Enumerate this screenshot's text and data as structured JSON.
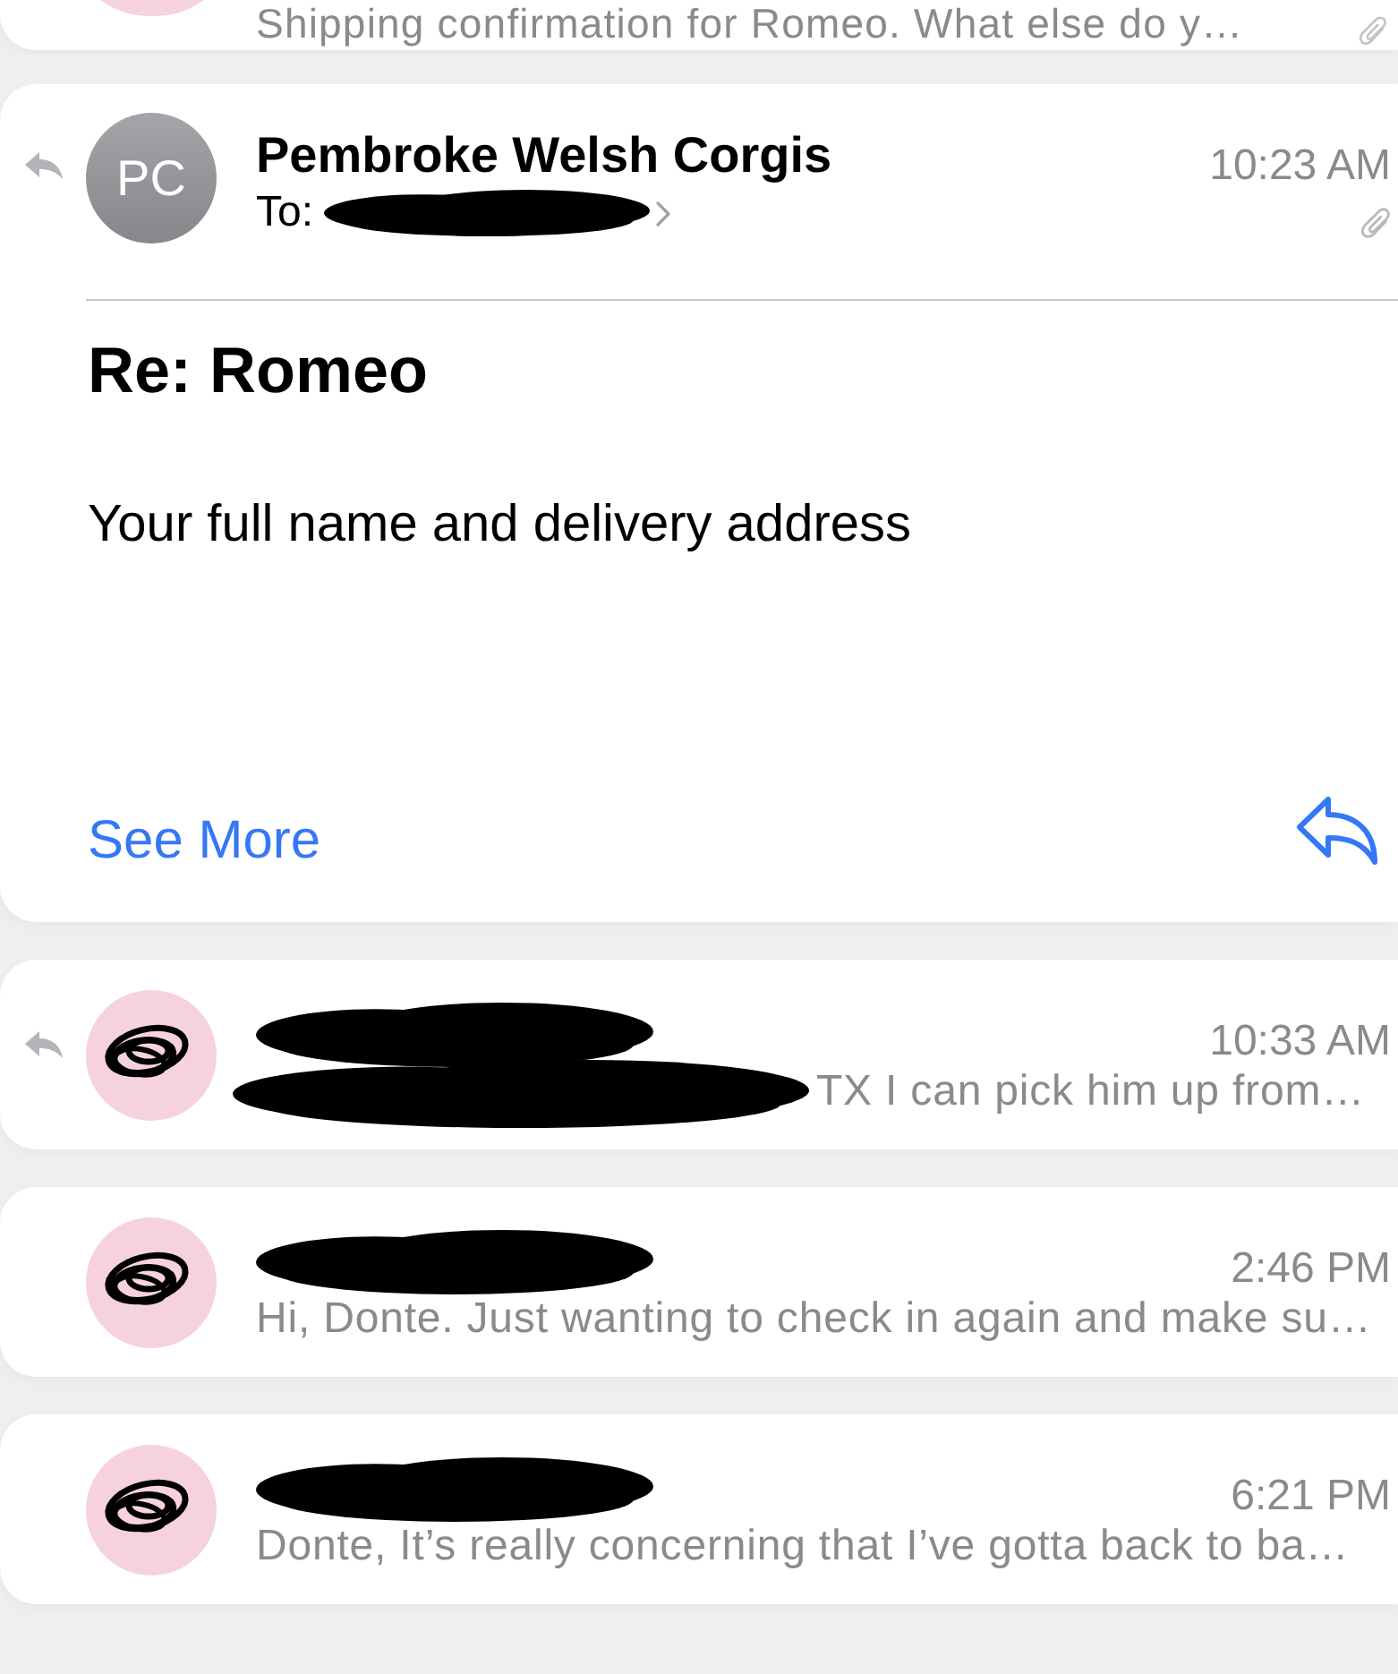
{
  "previous_message": {
    "preview": "Shipping confirmation for Romeo. What else do y…",
    "has_attachment": true
  },
  "open_message": {
    "replied": true,
    "initials": "PC",
    "sender": "Pembroke Welsh Corgis",
    "to_label": "To:",
    "time": "10:23 AM",
    "has_attachment": true,
    "subject": "Re: Romeo",
    "body": "Your full name and delivery address",
    "see_more": "See More"
  },
  "messages": [
    {
      "replied": true,
      "time": "10:33 AM",
      "preview_redacted": true,
      "preview": "TX I can pick him up from…"
    },
    {
      "replied": false,
      "time": "2:46 PM",
      "preview_redacted": false,
      "preview": "Hi, Donte. Just wanting to check in again and make su…"
    },
    {
      "replied": false,
      "time": "6:21 PM",
      "preview_redacted": false,
      "preview": "Donte, It’s really concerning that I’ve gotta back to ba…"
    }
  ]
}
